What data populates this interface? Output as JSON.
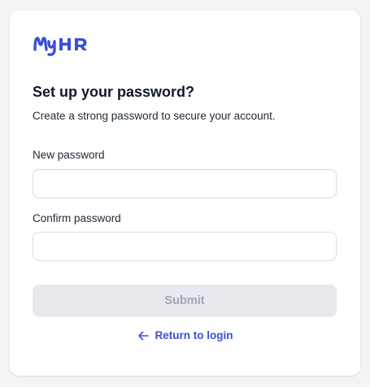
{
  "brand": {
    "logo_text": "MyHR",
    "accent_color": "#3b4fd8"
  },
  "form": {
    "title": "Set up your password?",
    "subtitle": "Create a strong password to secure your account.",
    "new_password": {
      "label": "New password",
      "value": "",
      "placeholder": ""
    },
    "confirm_password": {
      "label": "Confirm password",
      "value": "",
      "placeholder": ""
    },
    "submit_label": "Submit",
    "submit_state": "disabled",
    "return_link": {
      "label": "Return to login",
      "icon": "arrow-left-icon"
    }
  }
}
